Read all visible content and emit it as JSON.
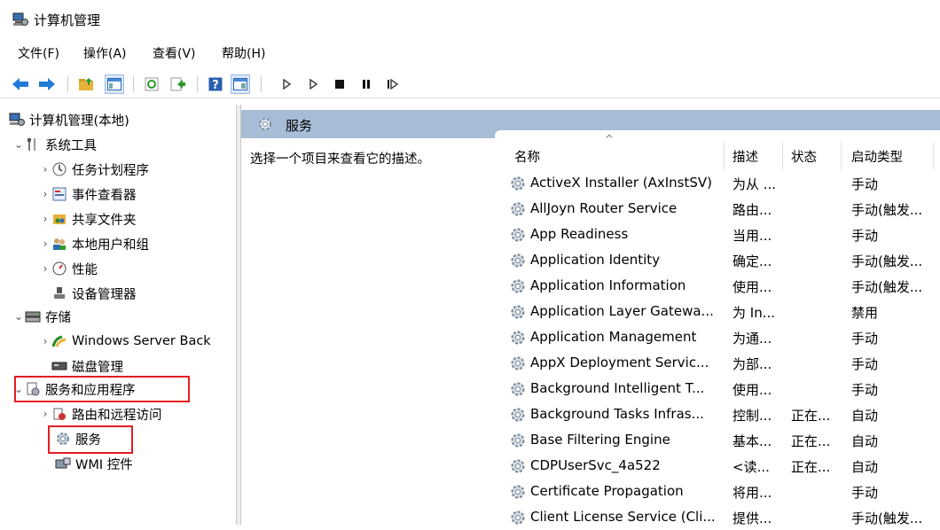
{
  "window": {
    "title": "计算机管理",
    "icon": "computer-management-icon"
  },
  "menu": [
    "文件(F)",
    "操作(A)",
    "查看(V)",
    "帮助(H)"
  ],
  "toolbar": {
    "icons": [
      "back-arrow-icon",
      "forward-arrow-icon",
      "up-folder-icon",
      "show-hide-tree-icon",
      "refresh-icon",
      "export-list-icon",
      "help-icon",
      "properties-pane-icon",
      "start-service-icon",
      "start-icon",
      "stop-service-icon",
      "pause-service-icon",
      "restart-service-icon"
    ]
  },
  "tree": {
    "root": "计算机管理(本地)",
    "system_tools": "系统工具",
    "task_scheduler": "任务计划程序",
    "event_viewer": "事件查看器",
    "shared_folders": "共享文件夹",
    "local_users": "本地用户和组",
    "performance": "性能",
    "device_manager": "设备管理器",
    "storage": "存储",
    "windows_backup": "Windows Server Back",
    "disk_management": "磁盘管理",
    "services_apps": "服务和应用程序",
    "routing": "路由和远程访问",
    "services": "服务",
    "wmi": "WMI 控件"
  },
  "right": {
    "header": "服务",
    "description_prompt": "选择一个项目来查看它的描述。",
    "columns": {
      "name": "名称",
      "description": "描述",
      "status": "状态",
      "startup": "启动类型"
    },
    "rows": [
      {
        "name": "ActiveX Installer (AxInstSV)",
        "desc": "为从 ...",
        "status": "",
        "startup": "手动"
      },
      {
        "name": "AllJoyn Router Service",
        "desc": "路由...",
        "status": "",
        "startup": "手动(触发..."
      },
      {
        "name": "App Readiness",
        "desc": "当用...",
        "status": "",
        "startup": "手动"
      },
      {
        "name": "Application Identity",
        "desc": "确定...",
        "status": "",
        "startup": "手动(触发..."
      },
      {
        "name": "Application Information",
        "desc": "使用...",
        "status": "",
        "startup": "手动(触发..."
      },
      {
        "name": "Application Layer Gatewa...",
        "desc": "为 In...",
        "status": "",
        "startup": "禁用"
      },
      {
        "name": "Application Management",
        "desc": "为通...",
        "status": "",
        "startup": "手动"
      },
      {
        "name": "AppX Deployment Servic...",
        "desc": "为部...",
        "status": "",
        "startup": "手动"
      },
      {
        "name": "Background Intelligent T...",
        "desc": "使用...",
        "status": "",
        "startup": "手动"
      },
      {
        "name": "Background Tasks Infras...",
        "desc": "控制...",
        "status": "正在...",
        "startup": "自动"
      },
      {
        "name": "Base Filtering Engine",
        "desc": "基本...",
        "status": "正在...",
        "startup": "自动"
      },
      {
        "name": "CDPUserSvc_4a522",
        "desc": "<读...",
        "status": "正在...",
        "startup": "自动"
      },
      {
        "name": "Certificate Propagation",
        "desc": "将用...",
        "status": "",
        "startup": "手动"
      },
      {
        "name": "Client License Service (Cli...",
        "desc": "提供...",
        "status": "",
        "startup": "手动(触发..."
      }
    ]
  },
  "colors": {
    "header_bg": "#a8bcd6",
    "highlight": "#e51c23",
    "selected_toolbar": "#dbe7f6"
  }
}
